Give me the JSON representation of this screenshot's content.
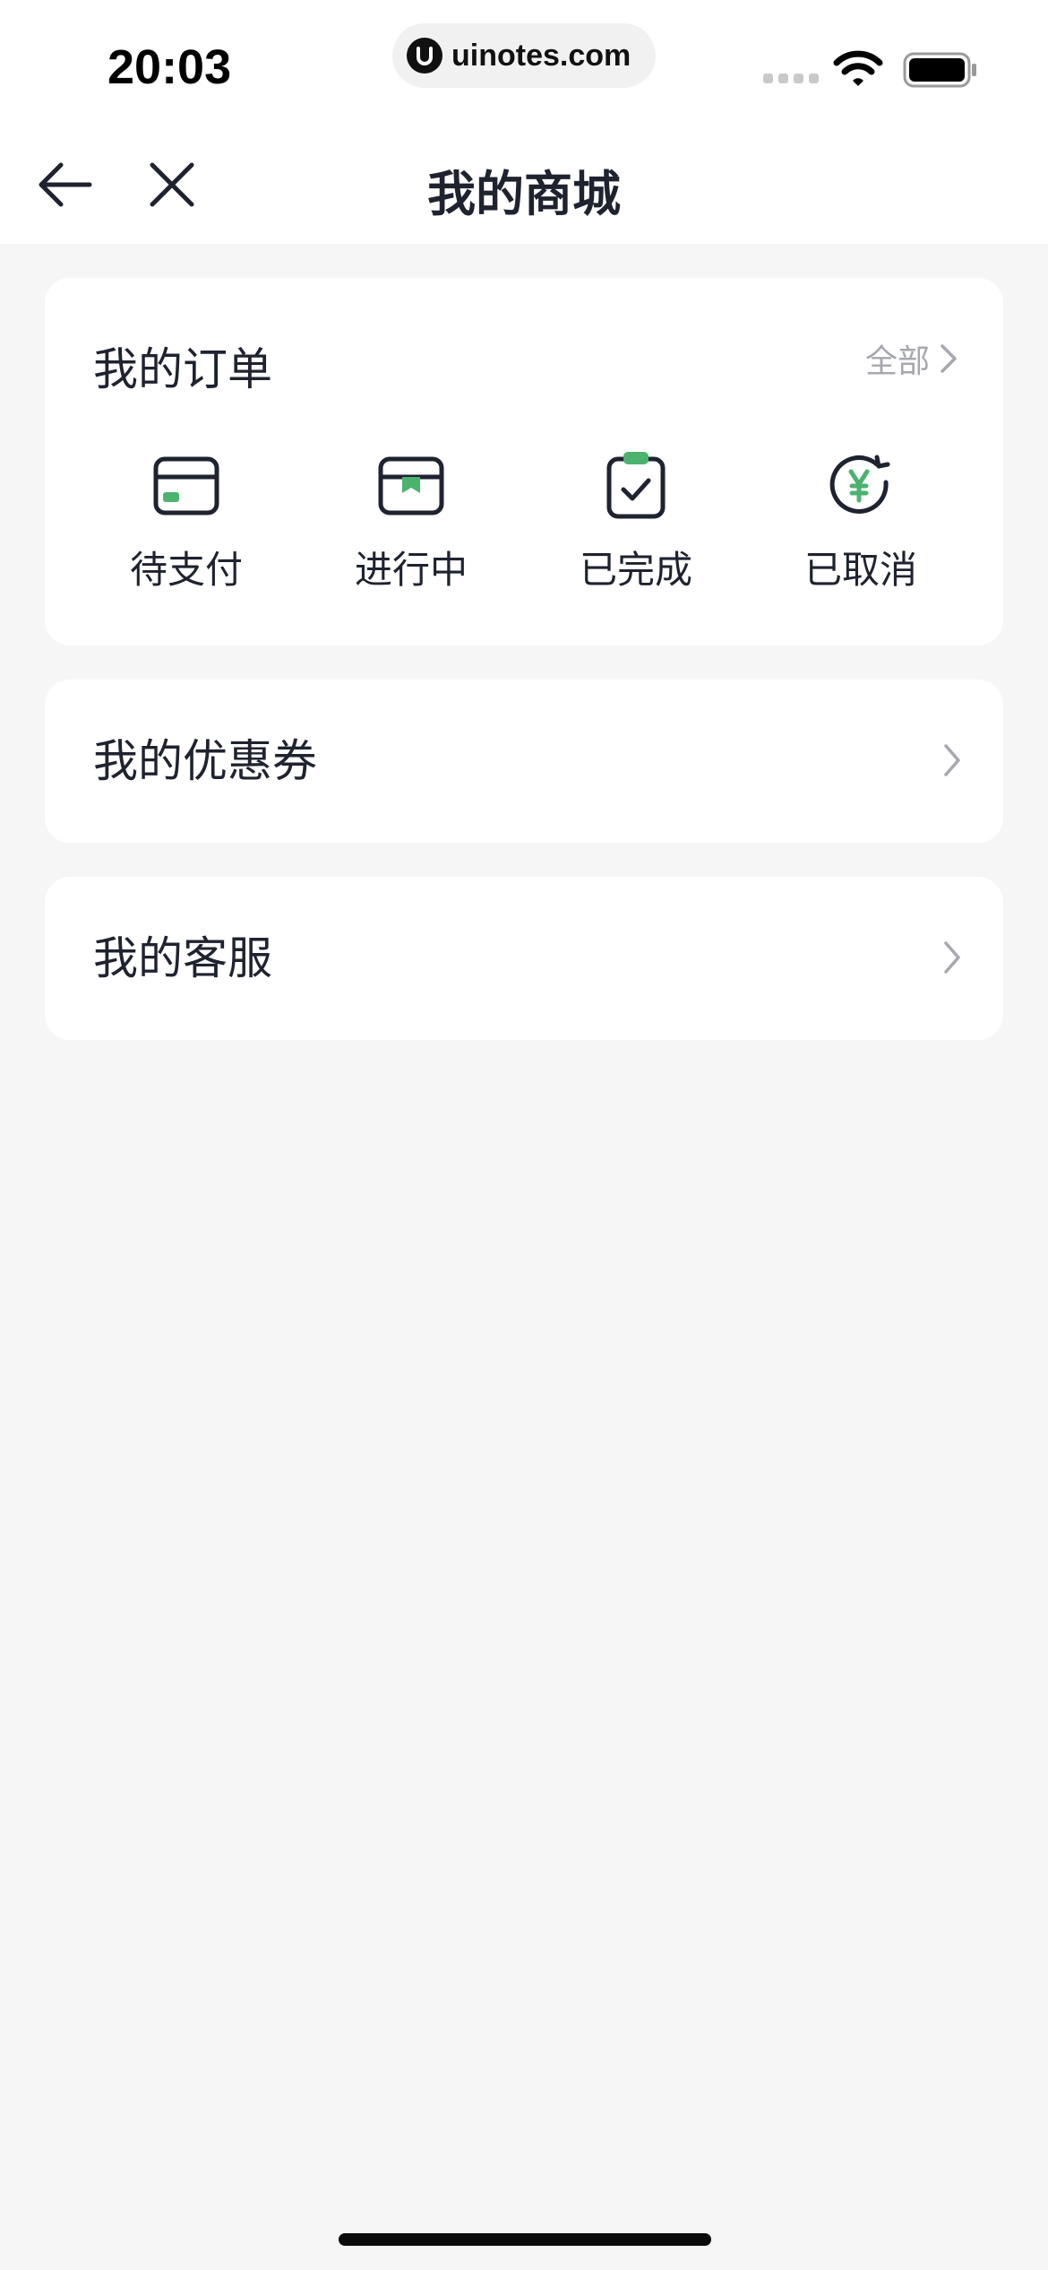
{
  "status_bar": {
    "time": "20:03",
    "url": "uinotes.com",
    "url_logo": "u-logo-icon"
  },
  "nav": {
    "title": "我的商城",
    "back_icon": "arrow-left-icon",
    "close_icon": "close-icon"
  },
  "orders": {
    "title": "我的订单",
    "all_label": "全部",
    "items": [
      {
        "label": "待支付",
        "icon": "card-icon"
      },
      {
        "label": "进行中",
        "icon": "package-icon"
      },
      {
        "label": "已完成",
        "icon": "clipboard-check-icon"
      },
      {
        "label": "已取消",
        "icon": "yen-refund-icon"
      }
    ]
  },
  "rows": [
    {
      "label": "我的优惠券"
    },
    {
      "label": "我的客服"
    }
  ],
  "colors": {
    "accent": "#4bb36e",
    "text": "#1f2330",
    "muted": "#a6a8ae",
    "background": "#f6f6f6"
  }
}
